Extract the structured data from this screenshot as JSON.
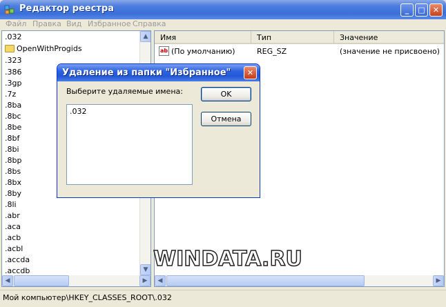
{
  "window": {
    "title": "Редактор реестра",
    "minimize_label": "_",
    "maximize_label": "□",
    "close_label": "✕"
  },
  "menu": [
    "Файл",
    "Правка",
    "Вид",
    "Избранное",
    "Справка"
  ],
  "tree": {
    "items": [
      ".032",
      "OpenWithProgids",
      ".323",
      ".386",
      ".3gp",
      ".7z",
      ".8ba",
      ".8bc",
      ".8be",
      ".8bf",
      ".8bi",
      ".8bp",
      ".8bs",
      ".8bx",
      ".8by",
      ".8li",
      ".abr",
      ".aca",
      ".acb",
      ".acbl",
      ".accda",
      ".accdb"
    ]
  },
  "list": {
    "columns": [
      "Имя",
      "Тип",
      "Значение"
    ],
    "rows": [
      {
        "icon": "string-value-icon",
        "icon_text": "ab",
        "name": "(По умолчанию)",
        "type": "REG_SZ",
        "value": "(значение не присвоено)"
      }
    ]
  },
  "statusbar": {
    "path": "Мой компьютер\\HKEY_CLASSES_ROOT\\.032"
  },
  "watermark": "WINDATA.RU",
  "dialog": {
    "title": "Удаление из папки \"Избранное\"",
    "close_label": "✕",
    "prompt": "Выберите удаляемые имена:",
    "items": [
      ".032"
    ],
    "ok_label": "OK",
    "cancel_label": "Отмена"
  }
}
